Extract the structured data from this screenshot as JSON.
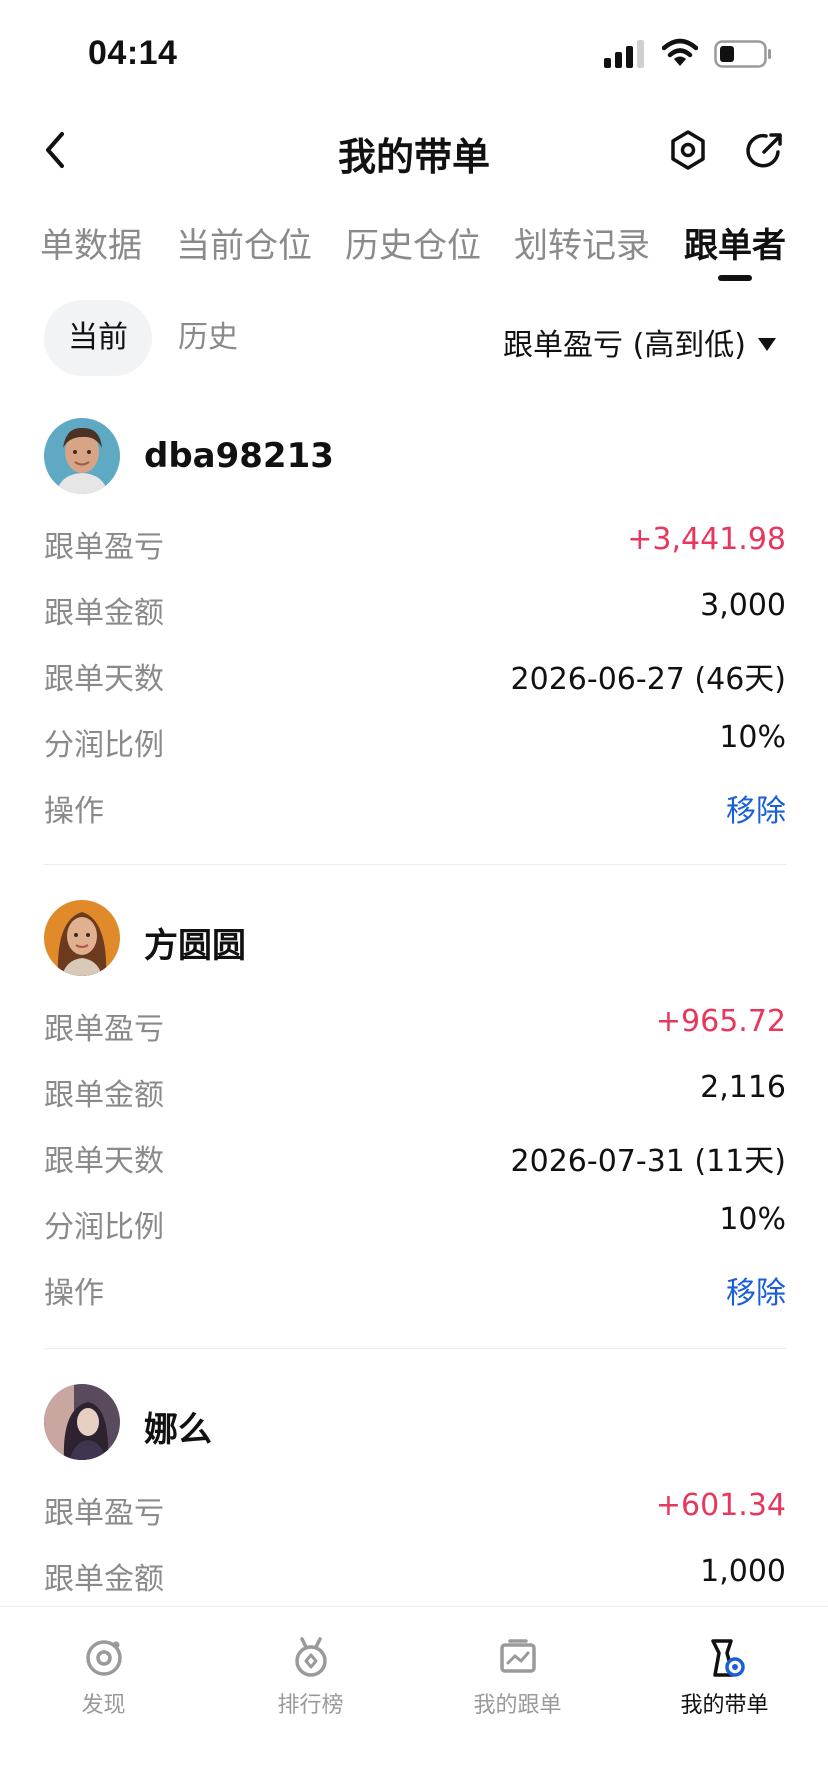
{
  "status_bar": {
    "time": "04:14"
  },
  "header": {
    "title": "我的带单"
  },
  "tabs": [
    {
      "label": "单数据",
      "active": false
    },
    {
      "label": "当前仓位",
      "active": false
    },
    {
      "label": "历史仓位",
      "active": false
    },
    {
      "label": "划转记录",
      "active": false
    },
    {
      "label": "跟单者",
      "active": true
    }
  ],
  "filter": {
    "segments": [
      "当前",
      "历史"
    ],
    "selected": "当前",
    "sort_label": "跟单盈亏 (高到低)"
  },
  "labels": {
    "pnl": "跟单盈亏",
    "amount": "跟单金额",
    "days": "跟单天数",
    "share": "分润比例",
    "action": "操作"
  },
  "followers": [
    {
      "name": "dba98213",
      "pnl": "+3,441.98",
      "amount": "3,000",
      "days": "2026-06-27 (46天)",
      "share": "10%",
      "action": "移除"
    },
    {
      "name": "方圆圆",
      "pnl": "+965.72",
      "amount": "2,116",
      "days": "2026-07-31 (11天)",
      "share": "10%",
      "action": "移除"
    },
    {
      "name": "娜么",
      "pnl": "+601.34",
      "amount": "1,000"
    }
  ],
  "bottom_nav": [
    {
      "label": "发现",
      "icon": "discover-icon",
      "active": false
    },
    {
      "label": "排行榜",
      "icon": "medal-icon",
      "active": false
    },
    {
      "label": "我的跟单",
      "icon": "chart-icon",
      "active": false
    },
    {
      "label": "我的带单",
      "icon": "lead-trade-icon",
      "active": true
    }
  ],
  "colors": {
    "positive": "#e8365d",
    "link": "#1a5fd8",
    "muted": "#8a8a8a"
  }
}
